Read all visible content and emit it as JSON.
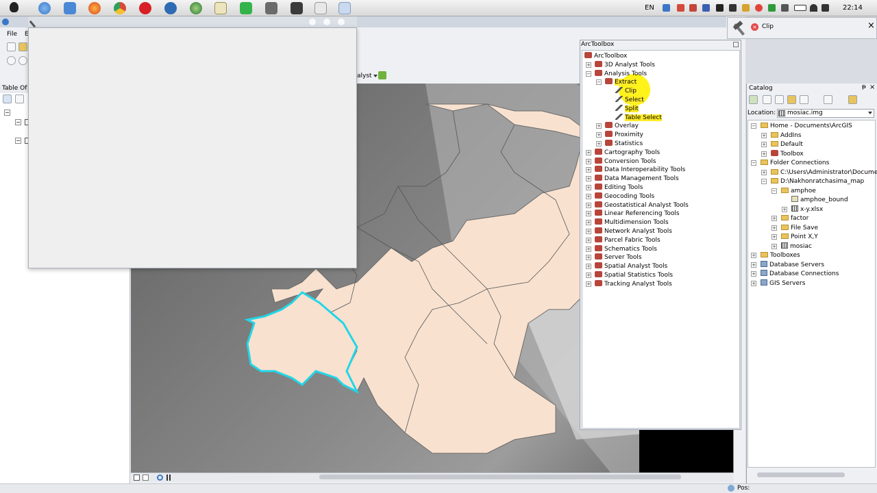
{
  "taskbar": {
    "language": "EN",
    "clock": "22:14"
  },
  "arcmap": {
    "menu": {
      "file": "File",
      "edit": "E"
    },
    "toc_title": "Table Of",
    "analyst_label": "alyst"
  },
  "clip_popup": {
    "label": "Clip"
  },
  "toolbox": {
    "title": "ArcToolbox",
    "root": "ArcToolbox",
    "items": [
      {
        "label": "3D Analyst Tools",
        "level": 1,
        "expander": "+"
      },
      {
        "label": "Analysis Tools",
        "level": 1,
        "expander": "−"
      },
      {
        "label": "Extract",
        "level": 2,
        "expander": "−"
      },
      {
        "label": "Clip",
        "level": 3,
        "tool": true
      },
      {
        "label": "Select",
        "level": 3,
        "tool": true
      },
      {
        "label": "Split",
        "level": 3,
        "tool": true
      },
      {
        "label": "Table Select",
        "level": 3,
        "tool": true
      },
      {
        "label": "Overlay",
        "level": 2,
        "expander": "+"
      },
      {
        "label": "Proximity",
        "level": 2,
        "expander": "+"
      },
      {
        "label": "Statistics",
        "level": 2,
        "expander": "+"
      },
      {
        "label": "Cartography Tools",
        "level": 1,
        "expander": "+"
      },
      {
        "label": "Conversion Tools",
        "level": 1,
        "expander": "+"
      },
      {
        "label": "Data Interoperability Tools",
        "level": 1,
        "expander": "+"
      },
      {
        "label": "Data Management Tools",
        "level": 1,
        "expander": "+"
      },
      {
        "label": "Editing Tools",
        "level": 1,
        "expander": "+"
      },
      {
        "label": "Geocoding Tools",
        "level": 1,
        "expander": "+"
      },
      {
        "label": "Geostatistical Analyst Tools",
        "level": 1,
        "expander": "+"
      },
      {
        "label": "Linear Referencing Tools",
        "level": 1,
        "expander": "+"
      },
      {
        "label": "Multidimension Tools",
        "level": 1,
        "expander": "+"
      },
      {
        "label": "Network Analyst Tools",
        "level": 1,
        "expander": "+"
      },
      {
        "label": "Parcel Fabric Tools",
        "level": 1,
        "expander": "+"
      },
      {
        "label": "Schematics Tools",
        "level": 1,
        "expander": "+"
      },
      {
        "label": "Server Tools",
        "level": 1,
        "expander": "+"
      },
      {
        "label": "Spatial Analyst Tools",
        "level": 1,
        "expander": "+"
      },
      {
        "label": "Spatial Statistics Tools",
        "level": 1,
        "expander": "+"
      },
      {
        "label": "Tracking Analyst Tools",
        "level": 1,
        "expander": "+"
      }
    ]
  },
  "catalog": {
    "title": "Catalog",
    "location_label": "Location:",
    "location_value": "mosiac.img",
    "items": [
      {
        "label": "Home - Documents\\ArcGIS",
        "level": 0,
        "icon": "folder",
        "expander": "−"
      },
      {
        "label": "AddIns",
        "level": 1,
        "icon": "folder",
        "expander": "+"
      },
      {
        "label": "Default",
        "level": 1,
        "icon": "folder",
        "expander": "+"
      },
      {
        "label": "Toolbox",
        "level": 1,
        "icon": "toolbox",
        "expander": "+"
      },
      {
        "label": "Folder Connections",
        "level": 0,
        "icon": "folder",
        "expander": "−"
      },
      {
        "label": "C:\\Users\\Administrator\\Document",
        "level": 1,
        "icon": "folder",
        "expander": "+"
      },
      {
        "label": "D:\\Nakhonratchasima_map",
        "level": 1,
        "icon": "folder",
        "expander": "−"
      },
      {
        "label": "amphoe",
        "level": 2,
        "icon": "folder",
        "expander": "−"
      },
      {
        "label": "amphoe_bound",
        "level": 3,
        "icon": "layer",
        "expander": ""
      },
      {
        "label": "x-y.xlsx",
        "level": 3,
        "icon": "raster",
        "expander": "+"
      },
      {
        "label": "factor",
        "level": 2,
        "icon": "folder",
        "expander": "+"
      },
      {
        "label": "File Save",
        "level": 2,
        "icon": "folder",
        "expander": "+"
      },
      {
        "label": "Point X,Y",
        "level": 2,
        "icon": "folder",
        "expander": "+"
      },
      {
        "label": "mosiac",
        "level": 2,
        "icon": "raster",
        "expander": "+"
      },
      {
        "label": "Toolboxes",
        "level": 0,
        "icon": "folder",
        "expander": "+"
      },
      {
        "label": "Database Servers",
        "level": 0,
        "icon": "server",
        "expander": "+"
      },
      {
        "label": "Database Connections",
        "level": 0,
        "icon": "server",
        "expander": "+"
      },
      {
        "label": "GIS Servers",
        "level": 0,
        "icon": "server",
        "expander": "+"
      }
    ]
  },
  "status": {
    "pos": "Pos:"
  },
  "colors": {
    "map_fill": "#f8e1cf",
    "selected_outline": "#22d6e8",
    "highlight": "#ffec2a"
  }
}
